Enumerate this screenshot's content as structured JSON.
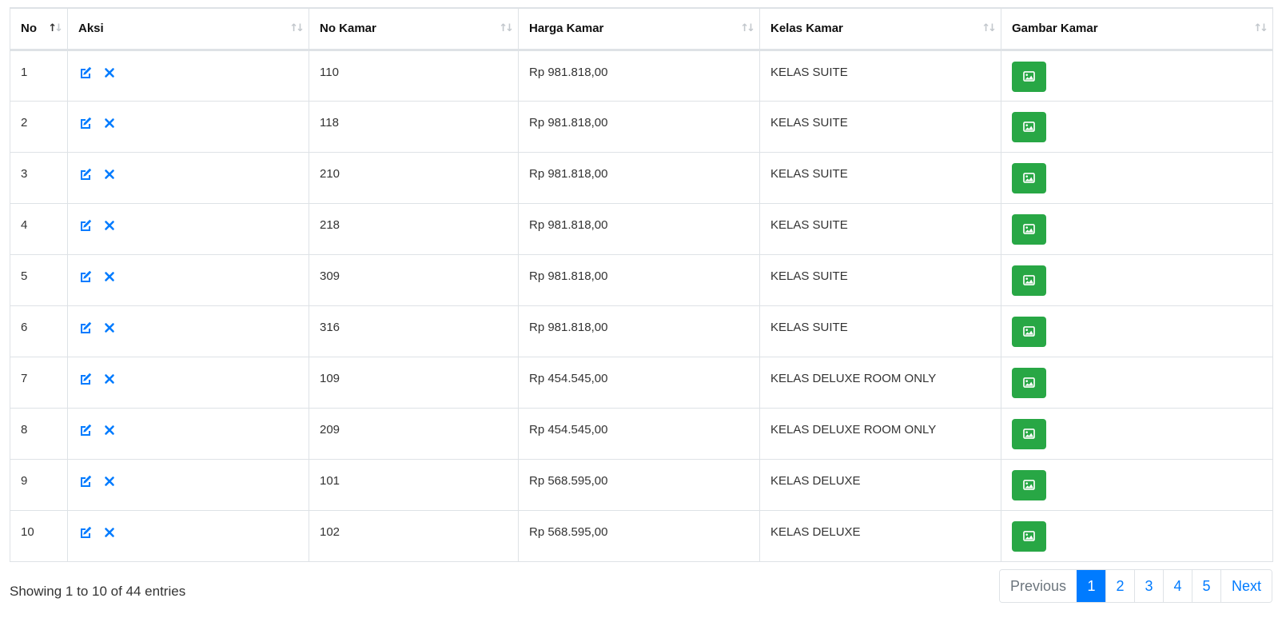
{
  "table": {
    "headers": [
      {
        "label": "No",
        "sort_active": true
      },
      {
        "label": "Aksi",
        "sort_active": false
      },
      {
        "label": "No Kamar",
        "sort_active": false
      },
      {
        "label": "Harga Kamar",
        "sort_active": false
      },
      {
        "label": "Kelas Kamar",
        "sort_active": false
      },
      {
        "label": "Gambar Kamar",
        "sort_active": false
      }
    ],
    "rows": [
      {
        "no": "1",
        "no_kamar": "110",
        "harga": "Rp 981.818,00",
        "kelas": "KELAS SUITE"
      },
      {
        "no": "2",
        "no_kamar": "118",
        "harga": "Rp 981.818,00",
        "kelas": "KELAS SUITE"
      },
      {
        "no": "3",
        "no_kamar": "210",
        "harga": "Rp 981.818,00",
        "kelas": "KELAS SUITE"
      },
      {
        "no": "4",
        "no_kamar": "218",
        "harga": "Rp 981.818,00",
        "kelas": "KELAS SUITE"
      },
      {
        "no": "5",
        "no_kamar": "309",
        "harga": "Rp 981.818,00",
        "kelas": "KELAS SUITE"
      },
      {
        "no": "6",
        "no_kamar": "316",
        "harga": "Rp 981.818,00",
        "kelas": "KELAS SUITE"
      },
      {
        "no": "7",
        "no_kamar": "109",
        "harga": "Rp 454.545,00",
        "kelas": "KELAS DELUXE ROOM ONLY"
      },
      {
        "no": "8",
        "no_kamar": "209",
        "harga": "Rp 454.545,00",
        "kelas": "KELAS DELUXE ROOM ONLY"
      },
      {
        "no": "9",
        "no_kamar": "101",
        "harga": "Rp 568.595,00",
        "kelas": "KELAS DELUXE"
      },
      {
        "no": "10",
        "no_kamar": "102",
        "harga": "Rp 568.595,00",
        "kelas": "KELAS DELUXE"
      }
    ],
    "action_icons": [
      "edit-icon",
      "delete-icon"
    ],
    "image_button_icon": "image-icon"
  },
  "footer": {
    "info": "Showing 1 to 10 of 44 entries",
    "pagination": {
      "previous": "Previous",
      "pages": [
        "1",
        "2",
        "3",
        "4",
        "5"
      ],
      "active_page": "1",
      "next": "Next"
    }
  },
  "colors": {
    "primary": "#007bff",
    "success": "#28a745",
    "border": "#dee2e6",
    "muted": "#6c757d"
  }
}
